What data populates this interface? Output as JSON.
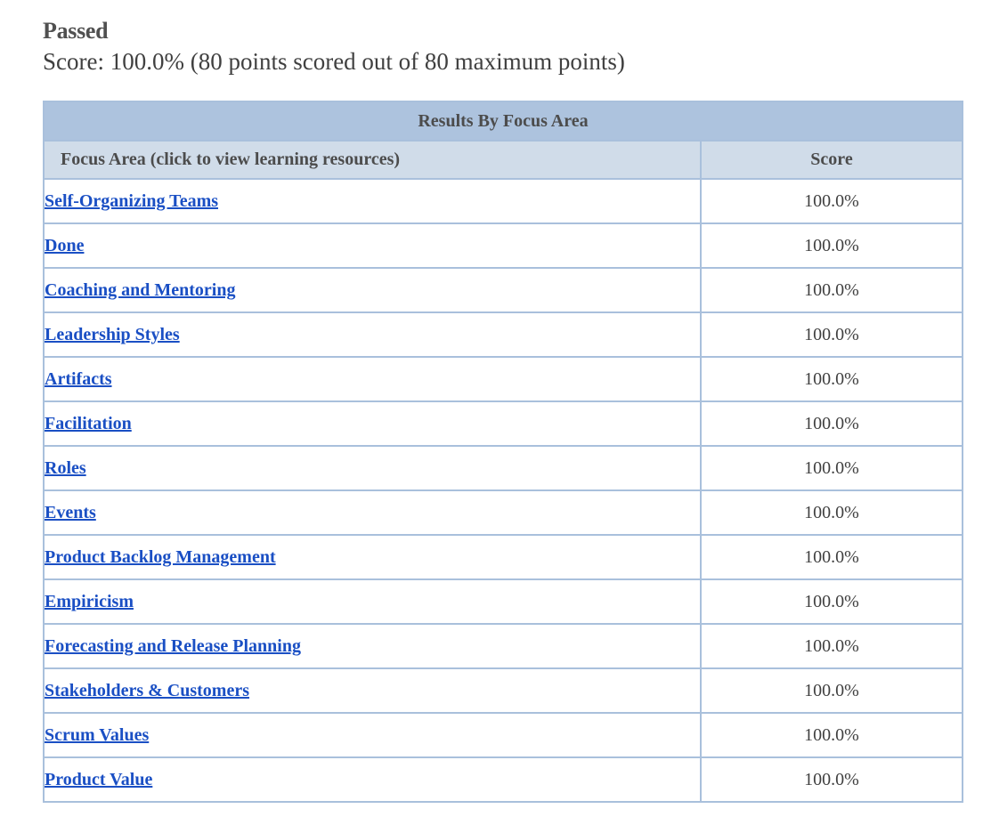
{
  "result": {
    "status": "Passed",
    "score_text": "Score: 100.0% (80 points scored out of 80 maximum points)"
  },
  "table": {
    "title": "Results By Focus Area",
    "headers": {
      "focus_area": "Focus Area (click to view learning resources)",
      "score": "Score"
    },
    "rows": [
      {
        "area": "Self-Organizing Teams",
        "score": "100.0%"
      },
      {
        "area": "Done",
        "score": "100.0%"
      },
      {
        "area": "Coaching and Mentoring",
        "score": "100.0%"
      },
      {
        "area": "Leadership Styles",
        "score": "100.0%"
      },
      {
        "area": "Artifacts",
        "score": "100.0%"
      },
      {
        "area": "Facilitation",
        "score": "100.0%"
      },
      {
        "area": "Roles",
        "score": "100.0%"
      },
      {
        "area": "Events",
        "score": "100.0%"
      },
      {
        "area": "Product Backlog Management",
        "score": "100.0%"
      },
      {
        "area": "Empiricism",
        "score": "100.0%"
      },
      {
        "area": "Forecasting and Release Planning",
        "score": "100.0%"
      },
      {
        "area": "Stakeholders & Customers",
        "score": "100.0%"
      },
      {
        "area": "Scrum Values",
        "score": "100.0%"
      },
      {
        "area": "Product Value",
        "score": "100.0%"
      }
    ]
  },
  "colors": {
    "link": "#1a4fc4",
    "title_bg": "#adc3de",
    "header_bg": "#d0dce9",
    "border": "#a9c0dc"
  }
}
